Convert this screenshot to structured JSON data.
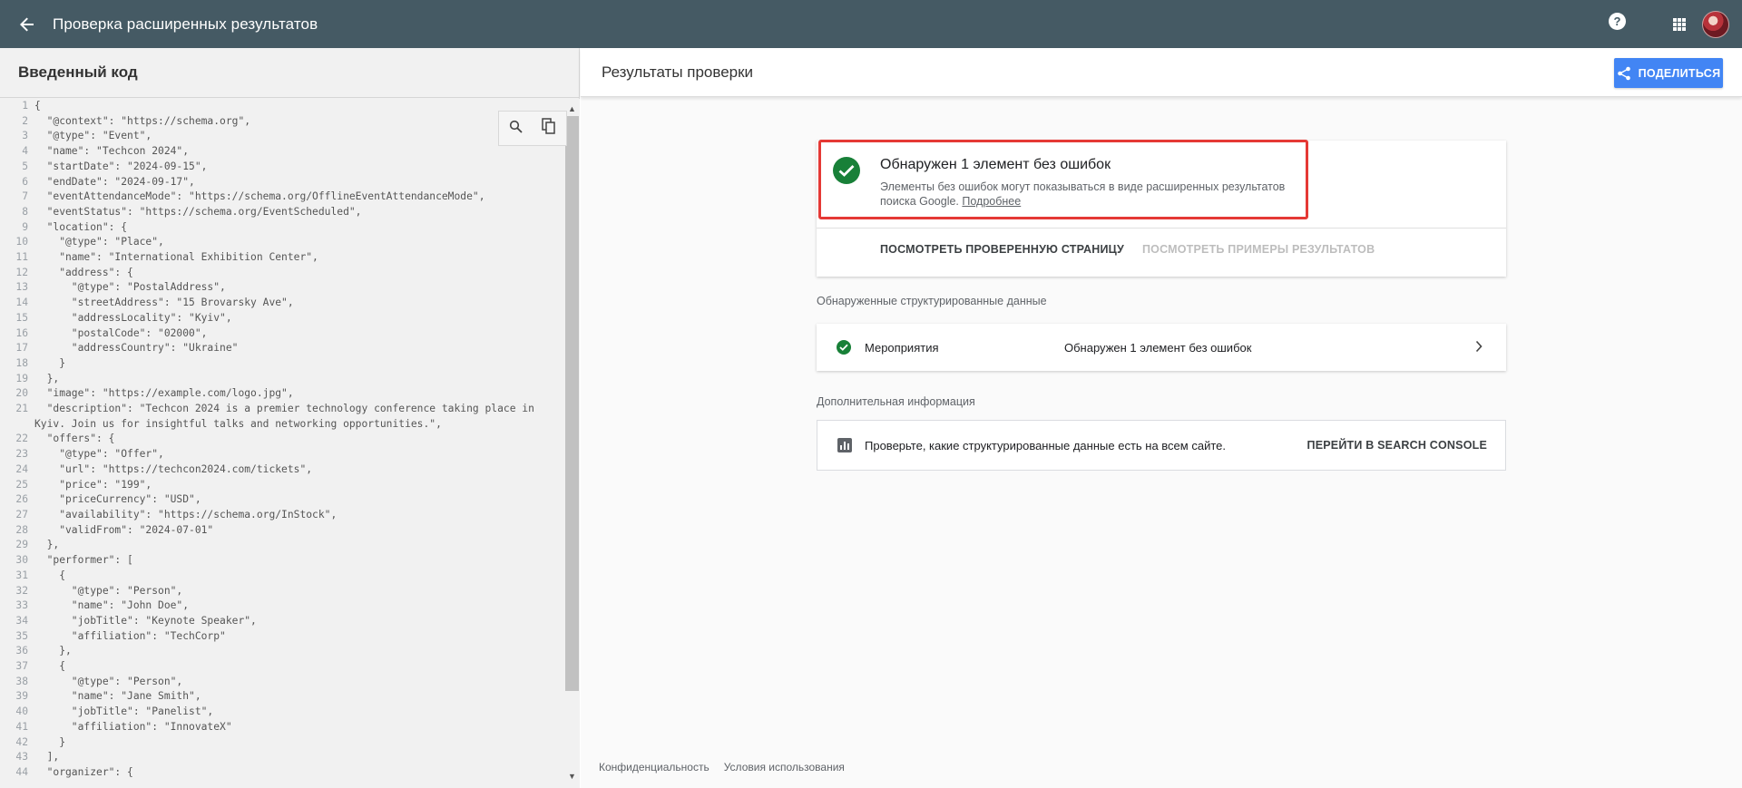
{
  "topbar": {
    "title": "Проверка расширенных результатов",
    "help_label": "?"
  },
  "left_panel": {
    "header": "Введенный код",
    "code_lines": [
      {
        "n": "1",
        "text": "{"
      },
      {
        "n": "2",
        "text": "  \"@context\": \"https://schema.org\","
      },
      {
        "n": "3",
        "text": "  \"@type\": \"Event\","
      },
      {
        "n": "4",
        "text": "  \"name\": \"Techcon 2024\","
      },
      {
        "n": "5",
        "text": "  \"startDate\": \"2024-09-15\","
      },
      {
        "n": "6",
        "text": "  \"endDate\": \"2024-09-17\","
      },
      {
        "n": "7",
        "text": "  \"eventAttendanceMode\": \"https://schema.org/OfflineEventAttendanceMode\","
      },
      {
        "n": "8",
        "text": "  \"eventStatus\": \"https://schema.org/EventScheduled\","
      },
      {
        "n": "9",
        "text": "  \"location\": {"
      },
      {
        "n": "10",
        "text": "    \"@type\": \"Place\","
      },
      {
        "n": "11",
        "text": "    \"name\": \"International Exhibition Center\","
      },
      {
        "n": "12",
        "text": "    \"address\": {"
      },
      {
        "n": "13",
        "text": "      \"@type\": \"PostalAddress\","
      },
      {
        "n": "14",
        "text": "      \"streetAddress\": \"15 Brovarsky Ave\","
      },
      {
        "n": "15",
        "text": "      \"addressLocality\": \"Kyiv\","
      },
      {
        "n": "16",
        "text": "      \"postalCode\": \"02000\","
      },
      {
        "n": "17",
        "text": "      \"addressCountry\": \"Ukraine\""
      },
      {
        "n": "18",
        "text": "    }"
      },
      {
        "n": "19",
        "text": "  },"
      },
      {
        "n": "20",
        "text": "  \"image\": \"https://example.com/logo.jpg\","
      },
      {
        "n": "21",
        "text": "  \"description\": \"Techcon 2024 is a premier technology conference taking place in"
      },
      {
        "n": "",
        "text": "Kyiv. Join us for insightful talks and networking opportunities.\","
      },
      {
        "n": "22",
        "text": "  \"offers\": {"
      },
      {
        "n": "23",
        "text": "    \"@type\": \"Offer\","
      },
      {
        "n": "24",
        "text": "    \"url\": \"https://techcon2024.com/tickets\","
      },
      {
        "n": "25",
        "text": "    \"price\": \"199\","
      },
      {
        "n": "26",
        "text": "    \"priceCurrency\": \"USD\","
      },
      {
        "n": "27",
        "text": "    \"availability\": \"https://schema.org/InStock\","
      },
      {
        "n": "28",
        "text": "    \"validFrom\": \"2024-07-01\""
      },
      {
        "n": "29",
        "text": "  },"
      },
      {
        "n": "30",
        "text": "  \"performer\": ["
      },
      {
        "n": "31",
        "text": "    {"
      },
      {
        "n": "32",
        "text": "      \"@type\": \"Person\","
      },
      {
        "n": "33",
        "text": "      \"name\": \"John Doe\","
      },
      {
        "n": "34",
        "text": "      \"jobTitle\": \"Keynote Speaker\","
      },
      {
        "n": "35",
        "text": "      \"affiliation\": \"TechCorp\""
      },
      {
        "n": "36",
        "text": "    },"
      },
      {
        "n": "37",
        "text": "    {"
      },
      {
        "n": "38",
        "text": "      \"@type\": \"Person\","
      },
      {
        "n": "39",
        "text": "      \"name\": \"Jane Smith\","
      },
      {
        "n": "40",
        "text": "      \"jobTitle\": \"Panelist\","
      },
      {
        "n": "41",
        "text": "      \"affiliation\": \"InnovateX\""
      },
      {
        "n": "42",
        "text": "    }"
      },
      {
        "n": "43",
        "text": "  ],"
      },
      {
        "n": "44",
        "text": "  \"organizer\": {"
      }
    ]
  },
  "right_panel": {
    "header": "Результаты проверки",
    "share_label": "ПОДЕЛИТЬСЯ",
    "result_card": {
      "title": "Обнаружен 1 элемент без ошибок",
      "description": "Элементы без ошибок могут показываться в виде расширенных результатов поиска Google.",
      "more_link": "Подробнее",
      "action_view_page": "ПОСМОТРЕТЬ ПРОВЕРЕННУЮ СТРАНИЦУ",
      "action_view_examples": "ПОСМОТРЕТЬ ПРИМЕРЫ РЕЗУЛЬТАТОВ"
    },
    "structured_data_label": "Обнаруженные структурированные данные",
    "item": {
      "name": "Мероприятия",
      "status": "Обнаружен 1 элемент без ошибок"
    },
    "additional_label": "Дополнительная информация",
    "info": {
      "text": "Проверьте, какие структурированные данные есть на всем сайте.",
      "link": "ПЕРЕЙТИ В SEARCH CONSOLE"
    },
    "footer": {
      "privacy": "Конфиденциальность",
      "terms": "Условия использования"
    }
  },
  "colors": {
    "topbar": "#455a64",
    "accent": "#4285f4",
    "success": "#188038",
    "highlight": "#e53935"
  }
}
